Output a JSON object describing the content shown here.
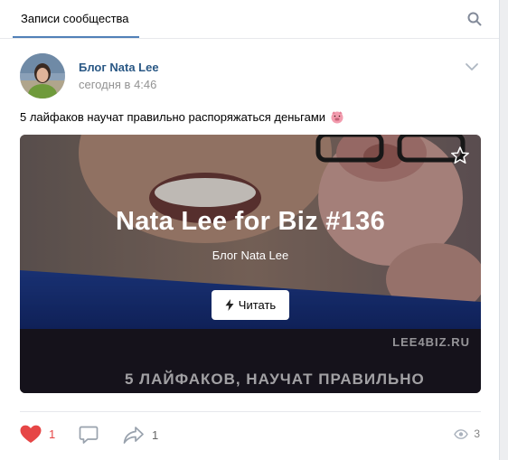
{
  "header": {
    "tab_label": "Записи сообщества"
  },
  "post": {
    "author": "Блог Nata Lee",
    "date": "сегодня в 4:46",
    "text": "5 лайфаков научат правильно распоряжаться деньгами",
    "emoji": "pig-face"
  },
  "article": {
    "title": "Nata Lee for Biz #136",
    "source": "Блог Nata Lee",
    "read_label": "Читать",
    "site_label": "LEE4BIZ.RU",
    "banner_text": "5 ЛАЙФАКОВ, НАУЧАТ ПРАВИЛЬНО"
  },
  "actions": {
    "likes": "1",
    "shares": "1",
    "views": "3"
  },
  "colors": {
    "link": "#2a5885",
    "accent": "#5181b8",
    "like": "#e64646",
    "muted": "#939393"
  }
}
